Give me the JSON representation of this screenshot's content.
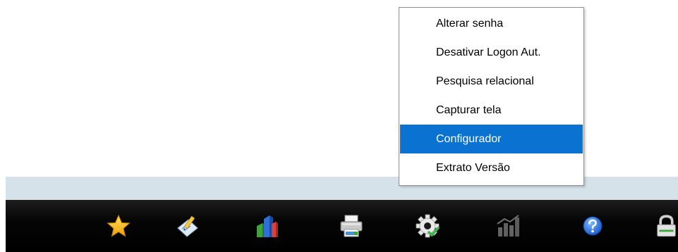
{
  "menu": {
    "items": [
      {
        "label": "Alterar senha",
        "selected": false
      },
      {
        "label": "Desativar Logon Aut.",
        "selected": false
      },
      {
        "label": "Pesquisa relacional",
        "selected": false
      },
      {
        "label": "Capturar tela",
        "selected": false
      },
      {
        "label": "Configurador",
        "selected": true
      },
      {
        "label": "Extrato Versão",
        "selected": false
      }
    ]
  },
  "toolbar": {
    "buttons": [
      {
        "icon": "star-icon"
      },
      {
        "icon": "notepad-pen-icon"
      },
      {
        "icon": "buildings-icon"
      },
      {
        "icon": "printer-icon"
      },
      {
        "icon": "gear-check-icon"
      },
      {
        "icon": "chart-icon"
      },
      {
        "icon": "help-icon"
      },
      {
        "icon": "lock-icon"
      }
    ]
  },
  "colors": {
    "menu_highlight": "#0a72d1",
    "band": "#d6e2ea",
    "toolbar": "#000000"
  }
}
